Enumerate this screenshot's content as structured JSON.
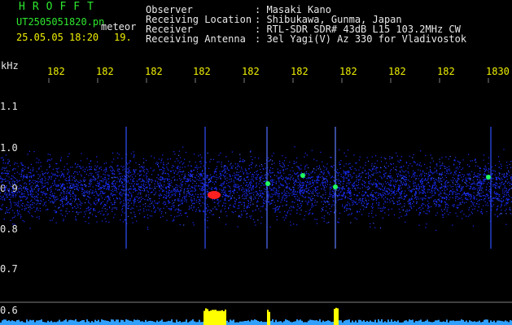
{
  "header": {
    "title": "HROFFT",
    "filename": "UT2505051820.pn",
    "meteor_label": "meteor",
    "datetime": "25.05.05 18:20",
    "counter": "19.",
    "fields": [
      {
        "label": "Observer",
        "value": ": Masaki Kano"
      },
      {
        "label": "Receiving Location",
        "value": ": Shibukawa, Gunma, Japan"
      },
      {
        "label": "Receiver",
        "value": ": RTL-SDR SDR# 43dB L15 103.2MHz CW"
      },
      {
        "label": "Receiving Antenna",
        "value": ": 3el Yagi(V) Az 330 for Vladivostok"
      }
    ]
  },
  "axis": {
    "y_unit": "kHz",
    "y_ticks": [
      "1.1",
      "1.0",
      "0.9",
      "0.8",
      "0.7",
      "0.6"
    ],
    "x_ticks": [
      "182",
      "182",
      "182",
      "182",
      "182",
      "182",
      "182",
      "182",
      "182",
      "1830"
    ]
  },
  "colors": {
    "background": "#000000",
    "noise": "#1a2cff",
    "echo_strong": "#ff2020",
    "echo_mid": "#20ff60",
    "baseline": "#ffff00",
    "grid": "#808080"
  },
  "echoes": [
    {
      "time_min": 18.43,
      "freq_khz": 0.87,
      "strength": "strong"
    },
    {
      "time_min": 18.49,
      "freq_khz": 0.9,
      "strength": "mid"
    },
    {
      "time_min": 18.5,
      "freq_khz": 0.9,
      "strength": "mid"
    },
    {
      "time_min": 18.56,
      "freq_khz": 0.92,
      "strength": "mid"
    },
    {
      "time_min": 18.62,
      "freq_khz": 0.92,
      "strength": "mid"
    }
  ]
}
